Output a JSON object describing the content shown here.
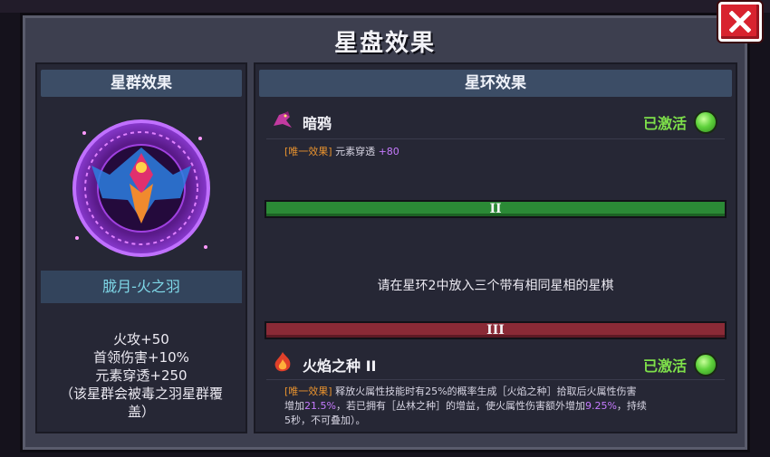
{
  "window": {
    "title": "星盘效果"
  },
  "left": {
    "header": "星群效果",
    "constellation_name": "胧月-火之羽",
    "stats": [
      "火攻+50",
      "首领伤害+10%",
      "元素穿透+250",
      "（该星群会被毒之羽星群覆",
      "盖）"
    ]
  },
  "right": {
    "header": "星环效果",
    "ring1": {
      "name": "暗鸦",
      "status": "已激活",
      "tag": "[唯一效果]",
      "desc": "元素穿透",
      "value": "+80"
    },
    "ring2": {
      "numeral": "II",
      "hint": "请在星环2中放入三个带有相同星相的星棋"
    },
    "ring3": {
      "numeral": "III",
      "name": "火焰之种 II",
      "status": "已激活",
      "tag": "[唯一效果]",
      "desc_a": "释放火属性技能时有25%的概率生成［火焰之种］拾取后火属性伤害",
      "desc_b": "增加",
      "value_a": "21.5%",
      "desc_c": "，若已拥有［丛林之种］的增益，使火属性伤害额外增加",
      "value_b": "9.25%",
      "desc_d": "，持续",
      "desc_e": "5秒，不可叠加）。"
    }
  },
  "colors": {
    "accent_green": "#7ee04a",
    "tag_orange": "#e8922e",
    "highlight_purple": "#c77bff",
    "name_cyan": "#7fd8e8"
  }
}
